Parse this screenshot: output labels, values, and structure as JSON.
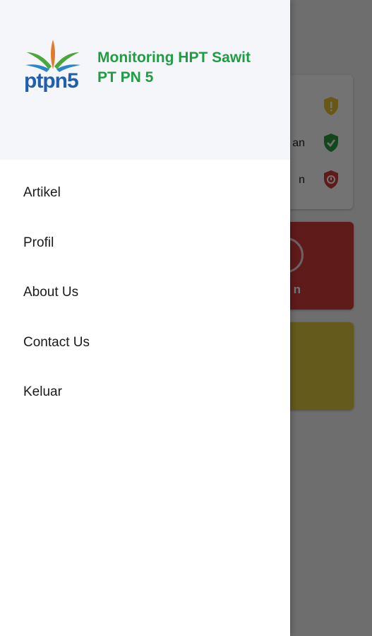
{
  "drawer": {
    "logo_text": "ptpn5",
    "title_line1": "Monitoring HPT Sawit",
    "title_line2": "PT PN 5",
    "brand_color": "#1f9d45",
    "menu": [
      {
        "label": "Artikel"
      },
      {
        "label": "Profil"
      },
      {
        "label": "About Us"
      },
      {
        "label": "Contact Us"
      },
      {
        "label": "Keluar"
      }
    ]
  },
  "background": {
    "status_rows": [
      {
        "text": "",
        "icon": "warning-shield-icon",
        "color": "#e8c12e"
      },
      {
        "text": "an",
        "icon": "check-shield-icon",
        "color": "#2e9b3c"
      },
      {
        "text": "n",
        "icon": "alert-shield-icon",
        "color": "#d33a3a"
      }
    ],
    "tile_red_label": "n"
  }
}
